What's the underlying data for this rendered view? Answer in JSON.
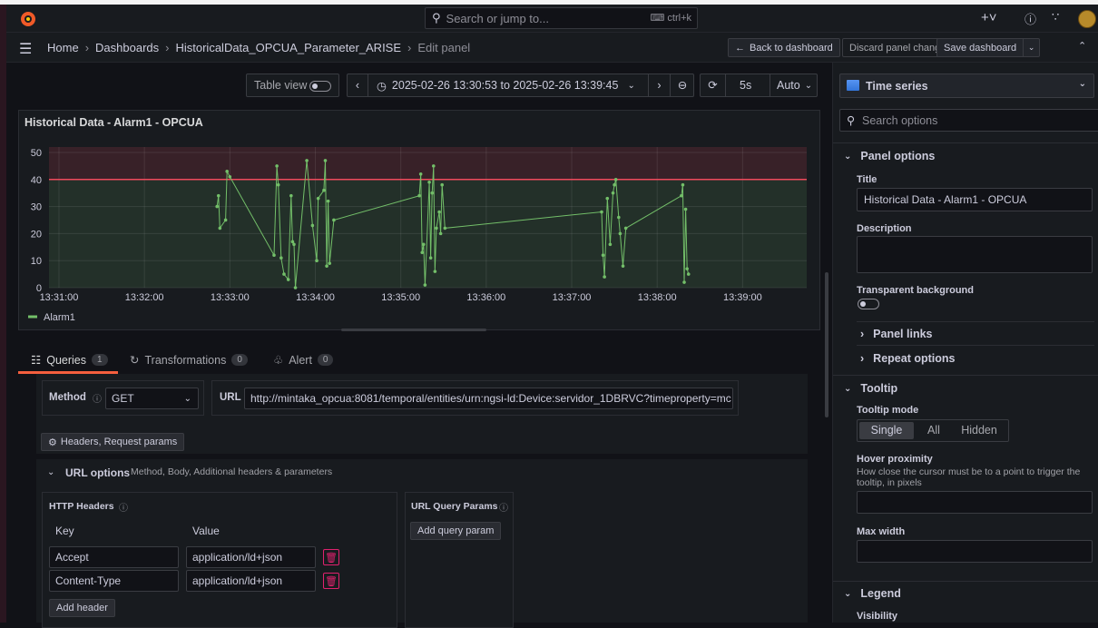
{
  "topbar": {
    "search_placeholder": "Search or jump to...",
    "search_shortcut": "ctrl+k"
  },
  "breadcrumb": [
    "Home",
    "Dashboards",
    "HistoricalData_OPCUA_Parameter_ARISE",
    "Edit panel"
  ],
  "nav_buttons": {
    "back": "Back to dashboard",
    "discard": "Discard panel changes",
    "save": "Save dashboard"
  },
  "toolbar": {
    "table_view": "Table view",
    "time_range": "2025-02-26 13:30:53 to 2025-02-26 13:39:45",
    "refresh_interval": "5s",
    "auto": "Auto"
  },
  "panel": {
    "title": "Historical Data - Alarm1 - OPCUA"
  },
  "chart_data": {
    "type": "line",
    "title": "Historical Data - Alarm1 - OPCUA",
    "x_ticks": [
      "13:31:00",
      "13:32:00",
      "13:33:00",
      "13:34:00",
      "13:35:00",
      "13:36:00",
      "13:37:00",
      "13:38:00",
      "13:39:00"
    ],
    "y_ticks": [
      0,
      10,
      20,
      30,
      40,
      50
    ],
    "ylim": [
      0,
      52
    ],
    "threshold": 40,
    "legend": "bottom-left",
    "series": [
      {
        "name": "Alarm1",
        "color": "#73bf69",
        "points": [
          [
            "13:32:51",
            30
          ],
          [
            "13:32:52",
            34
          ],
          [
            "13:32:53",
            22
          ],
          [
            "13:32:57",
            25
          ],
          [
            "13:32:58",
            43
          ],
          [
            "13:33:00",
            41
          ],
          [
            "13:33:31",
            12
          ],
          [
            "13:33:33",
            45
          ],
          [
            "13:33:34",
            38
          ],
          [
            "13:33:36",
            11
          ],
          [
            "13:33:38",
            5
          ],
          [
            "13:33:41",
            3
          ],
          [
            "13:33:43",
            34
          ],
          [
            "13:33:44",
            17
          ],
          [
            "13:33:45",
            16
          ],
          [
            "13:33:46",
            0
          ],
          [
            "13:33:54",
            47
          ],
          [
            "13:33:58",
            23
          ],
          [
            "13:34:01",
            10
          ],
          [
            "13:34:02",
            33
          ],
          [
            "13:34:06",
            36
          ],
          [
            "13:34:07",
            47
          ],
          [
            "13:34:08",
            8
          ],
          [
            "13:34:09",
            32
          ],
          [
            "13:34:10",
            9
          ],
          [
            "13:34:13",
            25
          ],
          [
            "13:35:13",
            34
          ],
          [
            "13:35:14",
            42
          ],
          [
            "13:35:15",
            13
          ],
          [
            "13:35:16",
            16
          ],
          [
            "13:35:17",
            1
          ],
          [
            "13:35:20",
            39
          ],
          [
            "13:35:21",
            11
          ],
          [
            "13:35:22",
            35
          ],
          [
            "13:35:23",
            45
          ],
          [
            "13:35:24",
            6
          ],
          [
            "13:35:25",
            22
          ],
          [
            "13:35:27",
            28
          ],
          [
            "13:35:28",
            20
          ],
          [
            "13:35:29",
            38
          ],
          [
            "13:35:31",
            22
          ],
          [
            "13:37:21",
            28
          ],
          [
            "13:37:22",
            12
          ],
          [
            "13:37:23",
            4
          ],
          [
            "13:37:25",
            33
          ],
          [
            "13:37:27",
            16
          ],
          [
            "13:37:29",
            35
          ],
          [
            "13:37:30",
            38
          ],
          [
            "13:37:31",
            40
          ],
          [
            "13:37:33",
            26
          ],
          [
            "13:37:34",
            20
          ],
          [
            "13:37:36",
            8
          ],
          [
            "13:37:38",
            22
          ],
          [
            "13:38:17",
            34
          ],
          [
            "13:38:18",
            38
          ],
          [
            "13:38:19",
            2
          ],
          [
            "13:38:20",
            29
          ],
          [
            "13:38:21",
            7
          ],
          [
            "13:38:22",
            5
          ]
        ]
      }
    ]
  },
  "query_tabs": [
    {
      "label": "Queries",
      "count": "1"
    },
    {
      "label": "Transformations",
      "count": "0"
    },
    {
      "label": "Alert",
      "count": "0"
    }
  ],
  "query": {
    "method_label": "Method",
    "method": "GET",
    "url_label": "URL",
    "url": "http://mintaka_opcua:8081/temporal/entities/urn:ngsi-ld:Device:servidor_1DBRVC?timeproperty=mc",
    "headers_btn": "Headers, Request params",
    "url_options": "URL options",
    "url_options_desc": "Method, Body, Additional headers & parameters",
    "http_headers": "HTTP Headers",
    "key_col": "Key",
    "value_col": "Value",
    "headers": [
      {
        "key": "Accept",
        "value": "application/ld+json"
      },
      {
        "key": "Content-Type",
        "value": "application/ld+json"
      }
    ],
    "add_header": "Add header",
    "query_params": "URL Query Params",
    "add_query_param": "Add query param"
  },
  "options": {
    "viz": "Time series",
    "search_placeholder": "Search options",
    "panel_options": "Panel options",
    "title_label": "Title",
    "title_value": "Historical Data - Alarm1 - OPCUA",
    "description_label": "Description",
    "transparent_label": "Transparent background",
    "panel_links": "Panel links",
    "repeat_options": "Repeat options",
    "tooltip": "Tooltip",
    "tooltip_mode": "Tooltip mode",
    "modes": [
      "Single",
      "All",
      "Hidden"
    ],
    "hover_label": "Hover proximity",
    "hover_desc": "How close the cursor must be to a point to trigger the tooltip, in pixels",
    "max_width": "Max width",
    "legend": "Legend",
    "visibility": "Visibility"
  }
}
